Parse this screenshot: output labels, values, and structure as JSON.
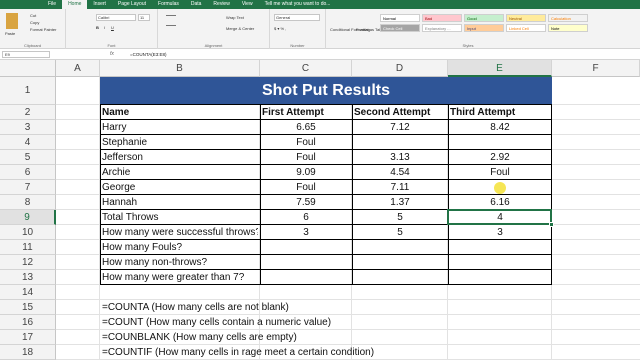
{
  "ribbon": {
    "tabs": [
      "File",
      "Home",
      "Insert",
      "Page Layout",
      "Formulas",
      "Data",
      "Review",
      "View",
      "Tell me what you want to do..."
    ],
    "active_tab": "Home",
    "clipboard": {
      "cut": "Cut",
      "copy": "Copy",
      "format_painter": "Format Painter",
      "paste": "Paste",
      "label": "Clipboard"
    },
    "font": {
      "name": "Calibri",
      "size": "11",
      "label": "Font"
    },
    "alignment": {
      "wrap": "Wrap Text",
      "merge": "Merge & Center",
      "label": "Alignment"
    },
    "number": {
      "format": "General",
      "label": "Number"
    },
    "styles": {
      "conditional": "Conditional Formatting",
      "format_table": "Format as Table",
      "label": "Styles",
      "cells": [
        {
          "text": "Normal",
          "bg": "#ffffff",
          "fg": "#000000"
        },
        {
          "text": "Bad",
          "bg": "#ffc7ce",
          "fg": "#9c0006"
        },
        {
          "text": "Good",
          "bg": "#c6efce",
          "fg": "#006100"
        },
        {
          "text": "Neutral",
          "bg": "#ffeb9c",
          "fg": "#9c5700"
        },
        {
          "text": "Calculation",
          "bg": "#f2f2f2",
          "fg": "#fa7d00"
        },
        {
          "text": "Check Cell",
          "bg": "#a5a5a5",
          "fg": "#ffffff"
        },
        {
          "text": "Explanatory ...",
          "bg": "#ffffff",
          "fg": "#7f7f7f"
        },
        {
          "text": "Input",
          "bg": "#ffcc99",
          "fg": "#3f3f76"
        },
        {
          "text": "Linked Cell",
          "bg": "#ffffff",
          "fg": "#fa7d00"
        },
        {
          "text": "Note",
          "bg": "#ffffcc",
          "fg": "#000000"
        }
      ]
    }
  },
  "formula_bar": {
    "name_box": "E9",
    "fx": "fx",
    "formula": "=COUNTA(E3:E8)"
  },
  "columns": [
    "A",
    "B",
    "C",
    "D",
    "E",
    "F"
  ],
  "selected_column": "E",
  "rows": [
    "1",
    "2",
    "3",
    "4",
    "5",
    "6",
    "7",
    "8",
    "9",
    "10",
    "11",
    "12",
    "13",
    "14",
    "15",
    "16",
    "17",
    "18"
  ],
  "selected_row": "9",
  "sheet": {
    "title": "Shot Put Results",
    "headers": [
      "Name",
      "First Attempt",
      "Second Attempt",
      "Third Attempt"
    ],
    "athletes": [
      {
        "name": "Harry",
        "first": "6.65",
        "second": "7.12",
        "third": "8.42"
      },
      {
        "name": "Stephanie",
        "first": "Foul",
        "second": "",
        "third": ""
      },
      {
        "name": "Jefferson",
        "first": "Foul",
        "second": "3.13",
        "third": "2.92"
      },
      {
        "name": "Archie",
        "first": "9.09",
        "second": "4.54",
        "third": "Foul"
      },
      {
        "name": "George",
        "first": "Foul",
        "second": "7.11",
        "third": ""
      },
      {
        "name": "Hannah",
        "first": "7.59",
        "second": "1.37",
        "third": "6.16"
      }
    ],
    "summary": [
      {
        "label": "Total Throws",
        "first": "6",
        "second": "5",
        "third": "4"
      },
      {
        "label": "How many were successful throws?",
        "first": "3",
        "second": "5",
        "third": "3"
      },
      {
        "label": "How many Fouls?",
        "first": "",
        "second": "",
        "third": ""
      },
      {
        "label": "How many non-throws?",
        "first": "",
        "second": "",
        "third": ""
      },
      {
        "label": "How many were greater than 7?",
        "first": "",
        "second": "",
        "third": ""
      }
    ],
    "notes": [
      "=COUNTA (How many cells are not blank)",
      "=COUNT (How many cells contain a numeric value)",
      "=COUNBLANK (How many cells are empty)",
      "=COUNTIF (How many cells in rage meet a certain condition)"
    ]
  },
  "colors": {
    "title_bg": "#2f5597",
    "excel_green": "#217346"
  }
}
